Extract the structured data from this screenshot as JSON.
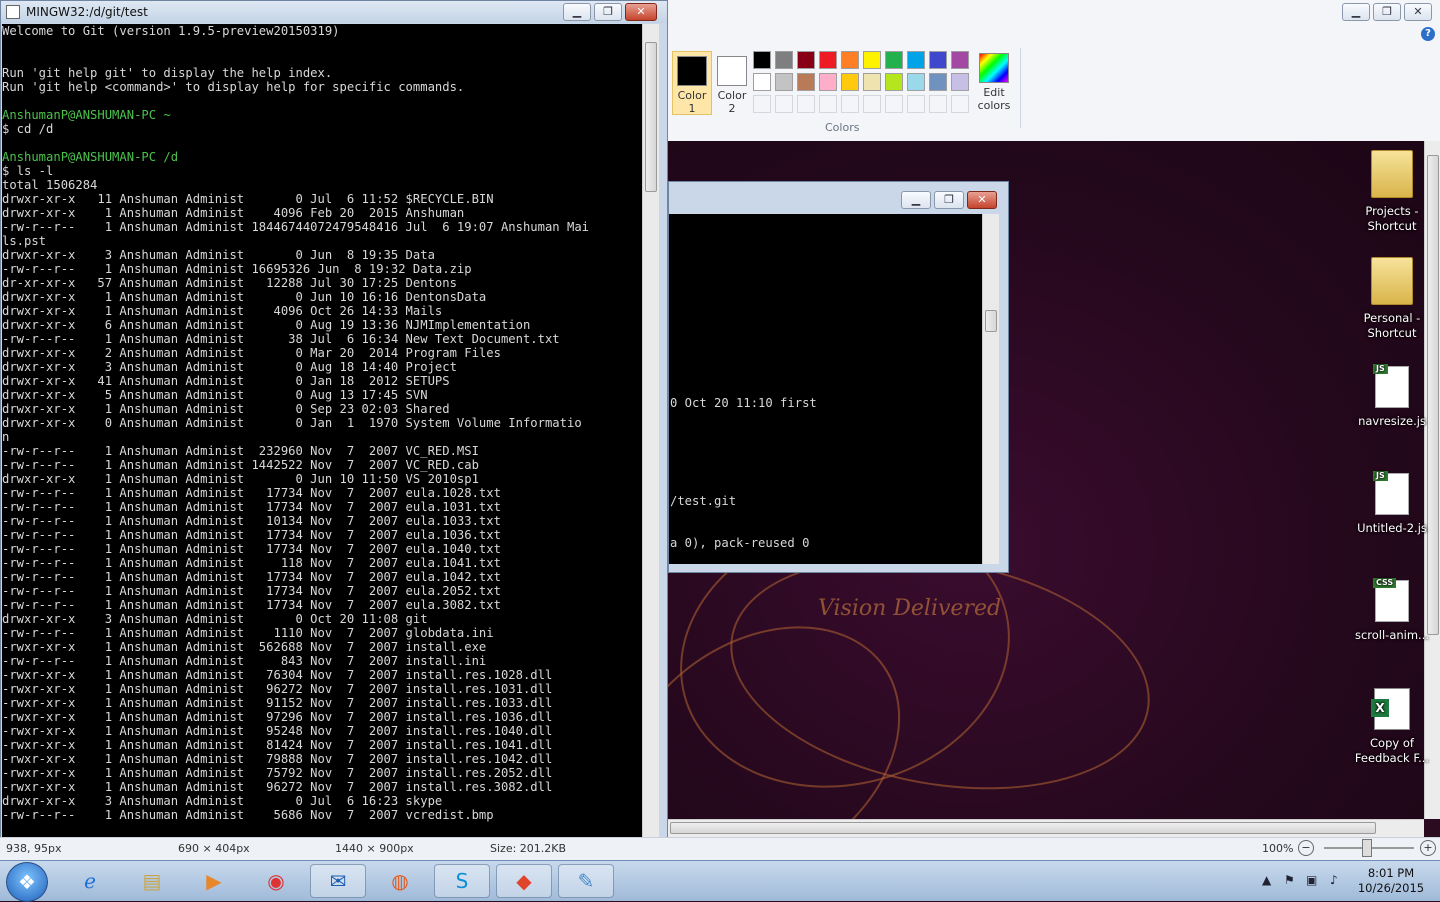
{
  "paint": {
    "color1_label": "Color 1",
    "color2_label": "Color 2",
    "colors_group_label": "Colors",
    "edit_colors_label": "Edit colors",
    "palette": [
      "#000000",
      "#7f7f7f",
      "#880015",
      "#ed1c24",
      "#ff7f27",
      "#fff200",
      "#22b14c",
      "#00a2e8",
      "#3f48cc",
      "#a349a4",
      "#ffffff",
      "#c3c3c3",
      "#b97a57",
      "#ffaec9",
      "#ffc90e",
      "#efe4b0",
      "#b5e61d",
      "#99d9ea",
      "#7092be",
      "#c8bfe7"
    ],
    "canvas_text": "Vision Delivered"
  },
  "git_window": {
    "title": "MINGW32:/d/git/test",
    "lines": [
      "Welcome to Git (version 1.9.5-preview20150319)",
      "",
      "",
      "Run 'git help git' to display the help index.",
      "Run 'git help <command>' to display help for specific commands.",
      "",
      "AnshumanP@ANSHUMAN-PC ~",
      "$ cd /d",
      "",
      "AnshumanP@ANSHUMAN-PC /d",
      "$ ls -l",
      "total 1506284",
      "drwxr-xr-x   11 Anshuman Administ       0 Jul  6 11:52 $RECYCLE.BIN",
      "drwxr-xr-x    1 Anshuman Administ    4096 Feb 20  2015 Anshuman",
      "-rw-r--r--    1 Anshuman Administ 18446744072479548416 Jul  6 19:07 Anshuman Mai",
      "ls.pst",
      "drwxr-xr-x    3 Anshuman Administ       0 Jun  8 19:35 Data",
      "-rw-r--r--    1 Anshuman Administ 16695326 Jun  8 19:32 Data.zip",
      "dr-xr-xr-x   57 Anshuman Administ   12288 Jul 30 17:25 Dentons",
      "drwxr-xr-x    1 Anshuman Administ       0 Jun 10 16:16 DentonsData",
      "drwxr-xr-x    1 Anshuman Administ    4096 Oct 26 14:33 Mails",
      "drwxr-xr-x    6 Anshuman Administ       0 Aug 19 13:36 NJMImplementation",
      "-rw-r--r--    1 Anshuman Administ      38 Jul  6 16:34 New Text Document.txt",
      "drwxr-xr-x    2 Anshuman Administ       0 Mar 20  2014 Program Files",
      "drwxr-xr-x    3 Anshuman Administ       0 Aug 18 14:40 Project",
      "drwxr-xr-x   41 Anshuman Administ       0 Jan 18  2012 SETUPS",
      "drwxr-xr-x    5 Anshuman Administ       0 Aug 13 17:45 SVN",
      "drwxr-xr-x    1 Anshuman Administ       0 Sep 23 02:03 Shared",
      "drwxr-xr-x    0 Anshuman Administ       0 Jan  1  1970 System Volume Informatio",
      "n",
      "-rw-r--r--    1 Anshuman Administ  232960 Nov  7  2007 VC_RED.MSI",
      "-rw-r--r--    1 Anshuman Administ 1442522 Nov  7  2007 VC_RED.cab",
      "drwxr-xr-x    1 Anshuman Administ       0 Jun 10 11:50 VS 2010sp1",
      "-rw-r--r--    1 Anshuman Administ   17734 Nov  7  2007 eula.1028.txt",
      "-rw-r--r--    1 Anshuman Administ   17734 Nov  7  2007 eula.1031.txt",
      "-rw-r--r--    1 Anshuman Administ   10134 Nov  7  2007 eula.1033.txt",
      "-rw-r--r--    1 Anshuman Administ   17734 Nov  7  2007 eula.1036.txt",
      "-rw-r--r--    1 Anshuman Administ   17734 Nov  7  2007 eula.1040.txt",
      "-rw-r--r--    1 Anshuman Administ     118 Nov  7  2007 eula.1041.txt",
      "-rw-r--r--    1 Anshuman Administ   17734 Nov  7  2007 eula.1042.txt",
      "-rw-r--r--    1 Anshuman Administ   17734 Nov  7  2007 eula.2052.txt",
      "-rw-r--r--    1 Anshuman Administ   17734 Nov  7  2007 eula.3082.txt",
      "drwxr-xr-x    3 Anshuman Administ       0 Oct 20 11:08 git",
      "-rw-r--r--    1 Anshuman Administ    1110 Nov  7  2007 globdata.ini",
      "-rwxr-xr-x    1 Anshuman Administ  562688 Nov  7  2007 install.exe",
      "-rw-r--r--    1 Anshuman Administ     843 Nov  7  2007 install.ini",
      "-rwxr-xr-x    1 Anshuman Administ   76304 Nov  7  2007 install.res.1028.dll",
      "-rwxr-xr-x    1 Anshuman Administ   96272 Nov  7  2007 install.res.1031.dll",
      "-rwxr-xr-x    1 Anshuman Administ   91152 Nov  7  2007 install.res.1033.dll",
      "-rwxr-xr-x    1 Anshuman Administ   97296 Nov  7  2007 install.res.1036.dll",
      "-rwxr-xr-x    1 Anshuman Administ   95248 Nov  7  2007 install.res.1040.dll",
      "-rwxr-xr-x    1 Anshuman Administ   81424 Nov  7  2007 install.res.1041.dll",
      "-rwxr-xr-x    1 Anshuman Administ   79888 Nov  7  2007 install.res.1042.dll",
      "-rwxr-xr-x    1 Anshuman Administ   75792 Nov  7  2007 install.res.2052.dll",
      "-rwxr-xr-x    1 Anshuman Administ   96272 Nov  7  2007 install.res.3082.dll",
      "drwxr-xr-x    3 Anshuman Administ       0 Jul  6 16:23 skype",
      "-rw-r--r--    1 Anshuman Administ    5686 Nov  7  2007 vcredist.bmp"
    ],
    "green_line_indices": [
      6,
      9
    ]
  },
  "second_terminal": {
    "lines": [
      {
        "text": "0 Oct 20 11:10 first",
        "row": 13
      },
      {
        "text": "/test.git",
        "row": 20
      },
      {
        "text": "a 0), pack-reused 0",
        "row": 23
      }
    ]
  },
  "desktop_icons": [
    {
      "label": "Projects - Shortcut",
      "type": "folder"
    },
    {
      "label": "Personal - Shortcut",
      "type": "folder"
    },
    {
      "label": "navresize.js",
      "type": "js"
    },
    {
      "label": "Untitled-2.js",
      "type": "js"
    },
    {
      "label": "scroll-anim...",
      "type": "css"
    },
    {
      "label": "Copy of Feedback F...",
      "type": "excel"
    }
  ],
  "status_bar": {
    "cursor": "938, 95px",
    "selection": "690 × 404px",
    "image_size": "1440 × 900px",
    "file_size": "Size: 201.2KB",
    "zoom": "100%"
  },
  "taskbar": {
    "time": "8:01 PM",
    "date": "10/26/2015"
  }
}
